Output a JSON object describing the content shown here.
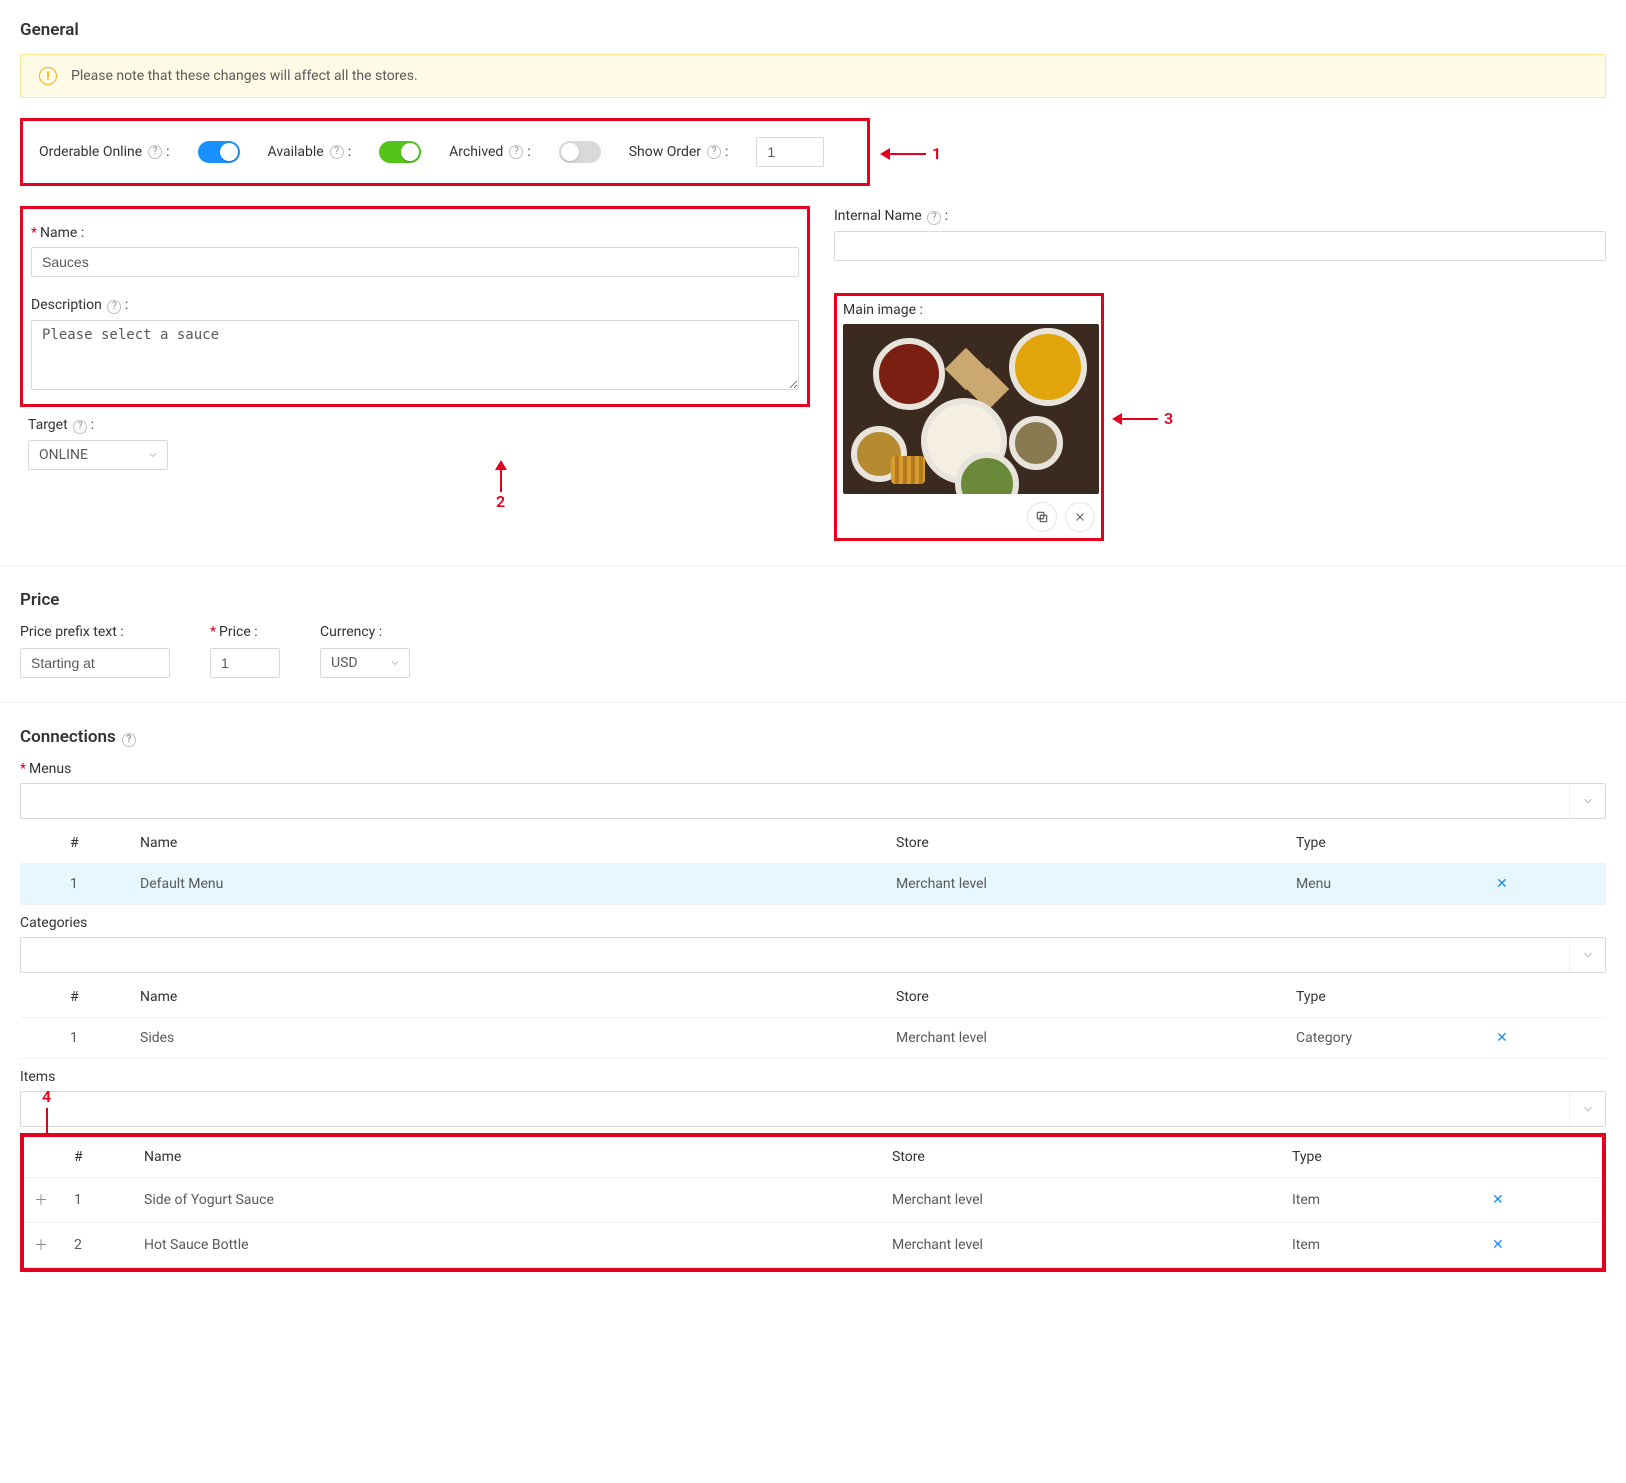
{
  "annotations": {
    "a1": "1",
    "a2": "2",
    "a3": "3",
    "a4": "4"
  },
  "general": {
    "title": "General",
    "alert": "Please note that these changes will affect all the stores.",
    "toggles": {
      "orderable_label": "Orderable Online",
      "available_label": "Available",
      "archived_label": "Archived",
      "show_order_label": "Show Order",
      "show_order_value": "1",
      "orderable_on": true,
      "available_on": true,
      "archived_on": false
    },
    "name_label": "Name",
    "name_value": "Sauces",
    "internal_name_label": "Internal Name",
    "internal_name_value": "",
    "description_label": "Description",
    "description_value": "Please select a sauce",
    "target_label": "Target",
    "target_value": "ONLINE",
    "main_image_label": "Main image"
  },
  "price": {
    "title": "Price",
    "prefix_label": "Price prefix text",
    "prefix_value": "Starting at",
    "price_label": "Price",
    "price_value": "1",
    "currency_label": "Currency",
    "currency_value": "USD"
  },
  "connections": {
    "title": "Connections",
    "menus_label": "Menus",
    "categories_label": "Categories",
    "items_label": "Items",
    "headers": {
      "hash": "#",
      "name": "Name",
      "store": "Store",
      "type": "Type"
    },
    "menus": [
      {
        "n": "1",
        "name": "Default Menu",
        "store": "Merchant level",
        "type": "Menu"
      }
    ],
    "categories": [
      {
        "n": "1",
        "name": "Sides",
        "store": "Merchant level",
        "type": "Category"
      }
    ],
    "items": [
      {
        "n": "1",
        "name": "Side of Yogurt Sauce",
        "store": "Merchant level",
        "type": "Item"
      },
      {
        "n": "2",
        "name": "Hot Sauce Bottle",
        "store": "Merchant level",
        "type": "Item"
      }
    ]
  }
}
